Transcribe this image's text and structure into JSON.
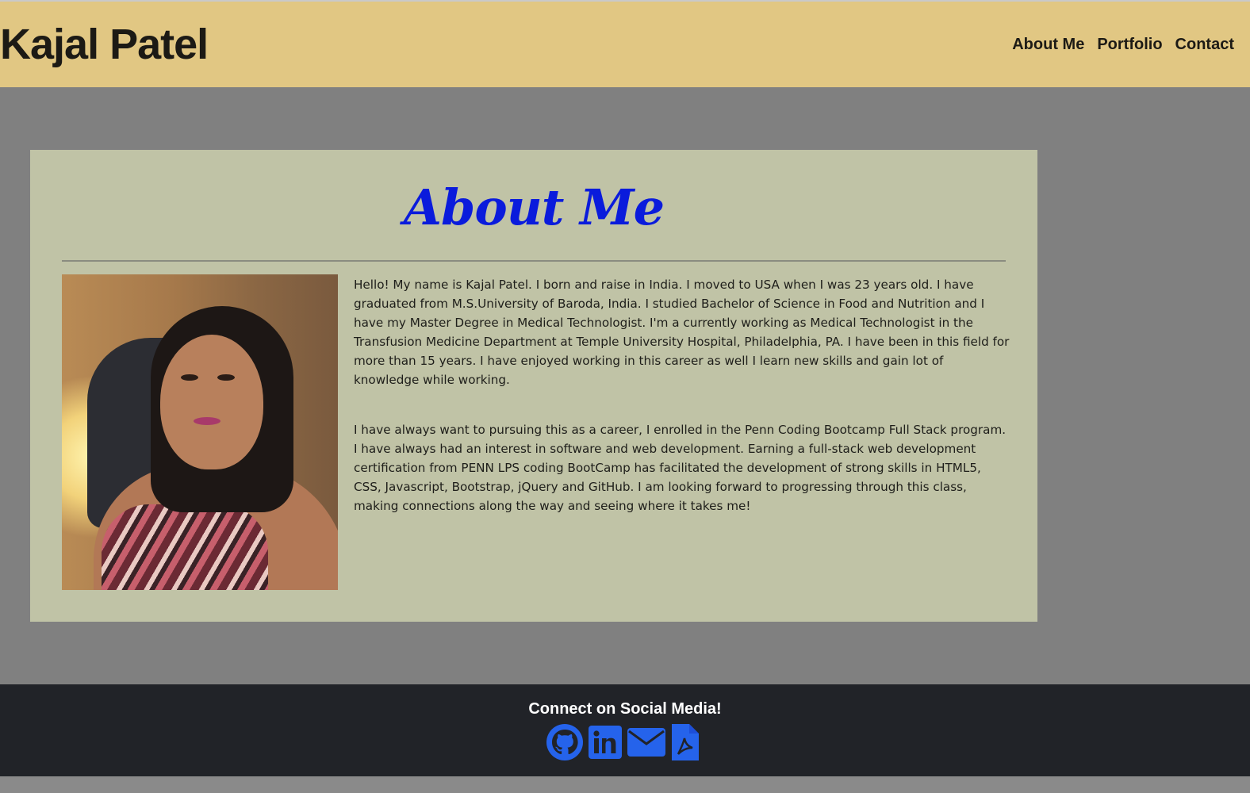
{
  "header": {
    "brand": "Kajal Patel",
    "nav": [
      "About Me",
      "Portfolio",
      "Contact"
    ]
  },
  "about": {
    "title": "About Me",
    "photo_alt": "Portrait photo of Kajal Patel",
    "paragraphs": [
      "Hello! My name is Kajal Patel. I born and raise in India. I moved to USA when I was 23 years old. I have graduated from M.S.University of Baroda, India. I studied Bachelor of Science in Food and Nutrition and I have my Master Degree in Medical Technologist. I'm a currently working as Medical Technologist in the Transfusion Medicine Department at Temple University Hospital, Philadelphia, PA. I have been in this field for more than 15 years. I have enjoyed working in this career as well I learn new skills and gain lot of knowledge while working.",
      "I have always want to pursuing this as a career, I enrolled in the Penn Coding Bootcamp Full Stack program. I have always had an interest in software and web development. Earning a full-stack web development certification from PENN LPS coding BootCamp has facilitated the development of strong skills in HTML5, CSS, Javascript, Bootstrap, jQuery and GitHub. I am looking forward to progressing through this class, making connections along the way and seeing where it takes me!"
    ]
  },
  "footer": {
    "title": "Connect on Social Media!",
    "icons": [
      "github-icon",
      "linkedin-icon",
      "email-icon",
      "pdf-resume-icon"
    ]
  },
  "colors": {
    "header_bg": "#e1c783",
    "page_bg": "#808080",
    "card_bg": "#c0c3a6",
    "title_blue": "#0a1bdc",
    "footer_bg": "#212328",
    "icon_blue": "#2563eb"
  }
}
